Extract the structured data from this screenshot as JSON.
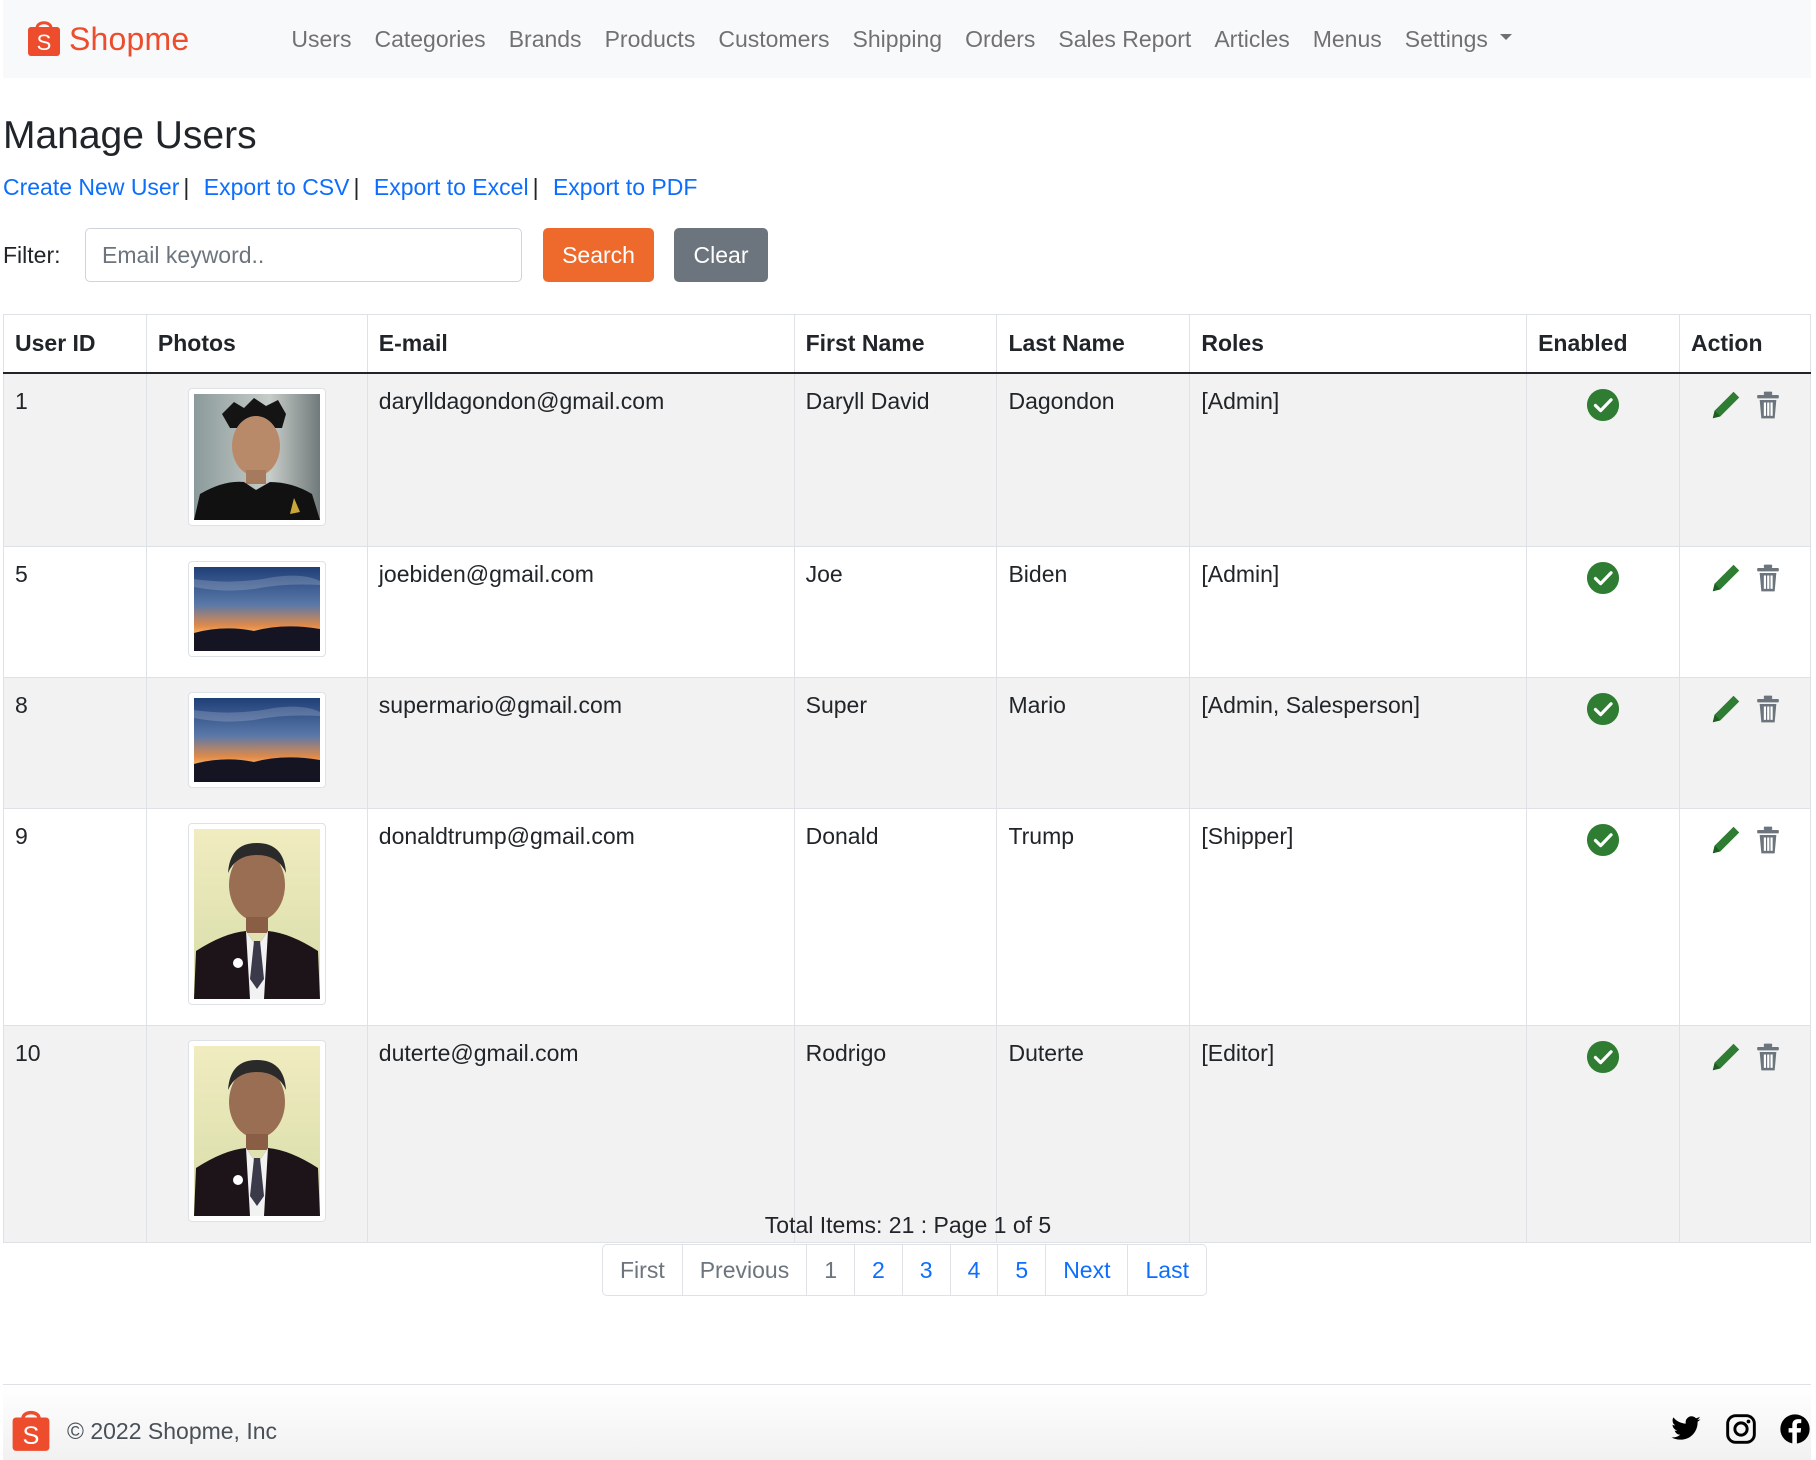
{
  "brand": {
    "name": "Shopme",
    "color": "#ee4d2d"
  },
  "nav": {
    "items": [
      "Users",
      "Categories",
      "Brands",
      "Products",
      "Customers",
      "Shipping",
      "Orders",
      "Sales Report",
      "Articles",
      "Menus"
    ],
    "settings_label": "Settings"
  },
  "page": {
    "title": "Manage Users",
    "actions": [
      "Create New User",
      "Export to CSV",
      "Export to Excel",
      "Export to PDF"
    ]
  },
  "filter": {
    "label": "Filter:",
    "placeholder": "Email keyword..",
    "value": "",
    "search_label": "Search",
    "clear_label": "Clear"
  },
  "table": {
    "columns": [
      "User ID",
      "Photos",
      "E-mail",
      "First Name",
      "Last Name",
      "Roles",
      "Enabled",
      "Action"
    ],
    "rows": [
      {
        "id": "1",
        "photo": "portrait-young-man",
        "email": "darylldagondon@gmail.com",
        "first": "Daryll David",
        "last": "Dagondon",
        "roles": "[Admin]",
        "enabled": true
      },
      {
        "id": "5",
        "photo": "sunset-landscape",
        "email": "joebiden@gmail.com",
        "first": "Joe",
        "last": "Biden",
        "roles": "[Admin]",
        "enabled": true
      },
      {
        "id": "8",
        "photo": "sunset-landscape",
        "email": "supermario@gmail.com",
        "first": "Super",
        "last": "Mario",
        "roles": "[Admin, Salesperson]",
        "enabled": true
      },
      {
        "id": "9",
        "photo": "portrait-man-suit",
        "email": "donaldtrump@gmail.com",
        "first": "Donald",
        "last": "Trump",
        "roles": "[Shipper]",
        "enabled": true
      },
      {
        "id": "10",
        "photo": "portrait-man-suit",
        "email": "duterte@gmail.com",
        "first": "Rodrigo",
        "last": "Duterte",
        "roles": "[Editor]",
        "enabled": true
      }
    ],
    "icons": {
      "enabled": "check-circle-icon",
      "edit": "pencil-icon",
      "delete": "trash-icon"
    },
    "colors": {
      "enabled": "#2e7d32",
      "edit": "#2e7d32",
      "delete": "#6c757d"
    }
  },
  "pagination": {
    "info": "Total Items: 21 : Page 1 of 5",
    "items": [
      {
        "label": "First",
        "disabled": true
      },
      {
        "label": "Previous",
        "disabled": true
      },
      {
        "label": "1",
        "disabled": true
      },
      {
        "label": "2",
        "disabled": false
      },
      {
        "label": "3",
        "disabled": false
      },
      {
        "label": "4",
        "disabled": false
      },
      {
        "label": "5",
        "disabled": false
      },
      {
        "label": "Next",
        "disabled": false
      },
      {
        "label": "Last",
        "disabled": false
      }
    ]
  },
  "footer": {
    "copyright": "© 2022 Shopme, Inc",
    "social": [
      "twitter-icon",
      "instagram-icon",
      "facebook-icon"
    ]
  }
}
